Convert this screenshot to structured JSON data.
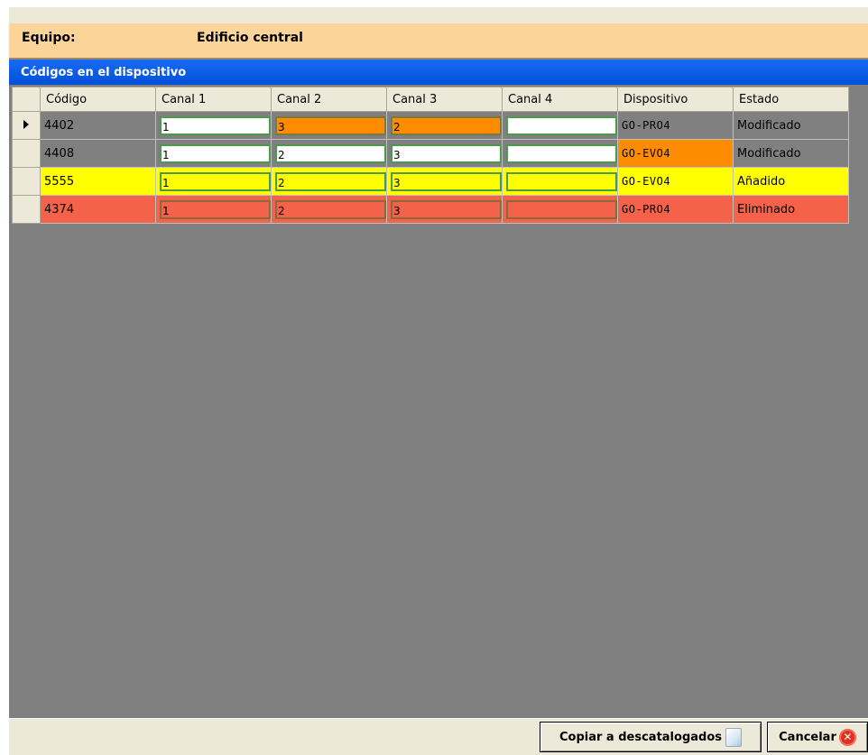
{
  "header": {
    "label": "Equipo:",
    "value": "Edificio central"
  },
  "grid": {
    "title": "Códigos en el dispositivo",
    "columns": [
      "Código",
      "Canal 1",
      "Canal 2",
      "Canal 3",
      "Canal 4",
      "Dispositivo",
      "Estado"
    ],
    "rows": [
      {
        "codigo": "4402",
        "canal1": "1",
        "canal2": "3",
        "canal3": "2",
        "canal4": "",
        "dispositivo": "GO-PRO4",
        "estado": "Modificado"
      },
      {
        "codigo": "4408",
        "canal1": "1",
        "canal2": "2",
        "canal3": "3",
        "canal4": "",
        "dispositivo": "GO-EVO4",
        "estado": "Modificado"
      },
      {
        "codigo": "5555",
        "canal1": "1",
        "canal2": "2",
        "canal3": "3",
        "canal4": "",
        "dispositivo": "GO-EVO4",
        "estado": "Añadido"
      },
      {
        "codigo": "4374",
        "canal1": "1",
        "canal2": "2",
        "canal3": "3",
        "canal4": "",
        "dispositivo": "GO-PRO4",
        "estado": "Eliminado"
      }
    ]
  },
  "colors": {
    "header_bg": "#fbd49a",
    "title_bar": "#0050d8",
    "modified_cell": "#ff8c00",
    "added_row": "#ffff00",
    "deleted_row": "#f4624a"
  },
  "buttons": {
    "copy_label": "Copiar a descatalogados",
    "copy_icon": "document-icon",
    "cancel_label": "Cancelar",
    "cancel_icon": "cancel-icon"
  }
}
